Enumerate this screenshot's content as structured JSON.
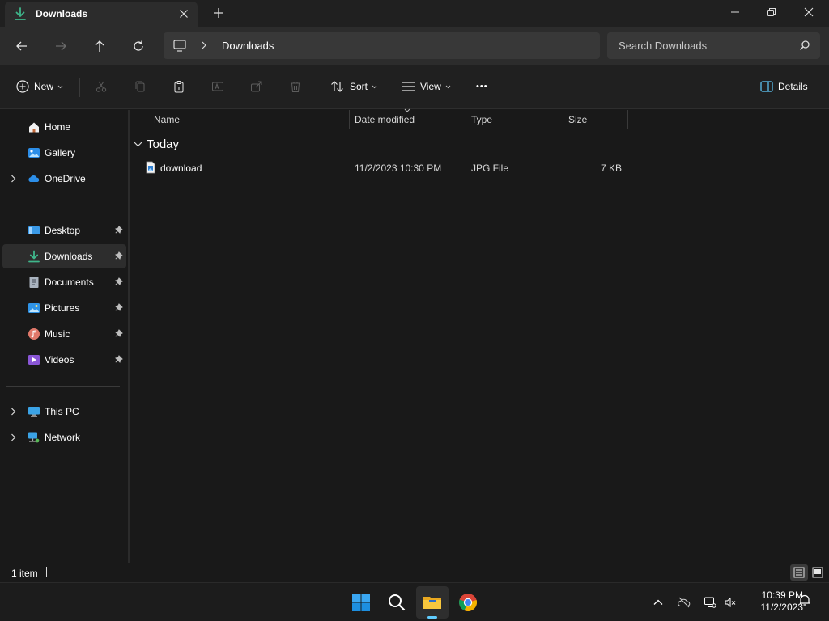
{
  "window": {
    "tab_title": "Downloads",
    "new_tab_symbol": "+"
  },
  "address": {
    "breadcrumb": [
      "Downloads"
    ],
    "search_placeholder": "Search Downloads"
  },
  "commands": {
    "new_label": "New",
    "sort_label": "Sort",
    "view_label": "View",
    "details_label": "Details",
    "more_symbol": "•••"
  },
  "sidebar": {
    "items": [
      {
        "label": "Home",
        "icon": "home-icon"
      },
      {
        "label": "Gallery",
        "icon": "gallery-icon"
      },
      {
        "label": "OneDrive",
        "icon": "onedrive-icon"
      },
      {
        "label": "Desktop",
        "icon": "desktop-icon",
        "pinned": true
      },
      {
        "label": "Downloads",
        "icon": "downloads-icon",
        "pinned": true,
        "selected": true
      },
      {
        "label": "Documents",
        "icon": "documents-icon",
        "pinned": true
      },
      {
        "label": "Pictures",
        "icon": "pictures-icon",
        "pinned": true
      },
      {
        "label": "Music",
        "icon": "music-icon",
        "pinned": true
      },
      {
        "label": "Videos",
        "icon": "videos-icon",
        "pinned": true
      },
      {
        "label": "This PC",
        "icon": "this-pc-icon"
      },
      {
        "label": "Network",
        "icon": "network-icon"
      }
    ]
  },
  "columns": {
    "name": "Name",
    "date": "Date modified",
    "type": "Type",
    "size": "Size"
  },
  "groups": [
    {
      "label": "Today",
      "files": [
        {
          "name": "download",
          "date": "11/2/2023 10:30 PM",
          "type": "JPG File",
          "size": "7 KB"
        }
      ]
    }
  ],
  "status": {
    "item_count": "1 item"
  },
  "taskbar": {
    "time": "10:39 PM",
    "date": "11/2/2023"
  },
  "colors": {
    "accent": "#60cdff",
    "download_green": "#3fb68b",
    "folder_yellow": "#f8c73d",
    "onedrive_blue": "#2c8ee8"
  }
}
